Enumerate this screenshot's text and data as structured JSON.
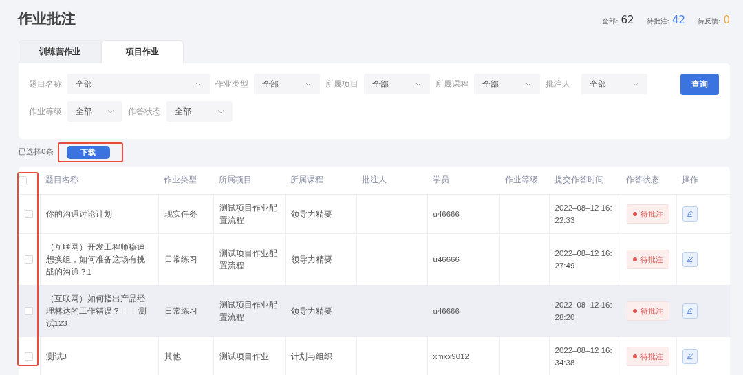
{
  "title": "作业批注",
  "stats": [
    {
      "label": "全部:",
      "value": "62",
      "color": "#333333"
    },
    {
      "label": "待批注:",
      "value": "42",
      "color": "#4a7ef0"
    },
    {
      "label": "待反馈:",
      "value": "0",
      "color": "#f2a93b"
    }
  ],
  "tabs": [
    {
      "label": "训练营作业",
      "selected": false
    },
    {
      "label": "项目作业",
      "selected": true
    }
  ],
  "filter_rows": [
    [
      {
        "label": "题目名称",
        "value": "全部"
      },
      {
        "label": "作业类型",
        "value": "全部"
      },
      {
        "label": "所属项目",
        "value": "全部"
      },
      {
        "label": "所属课程",
        "value": "全部"
      },
      {
        "label": "批注人",
        "value": "全部"
      }
    ],
    [
      {
        "label": "作业等级",
        "value": "全部"
      },
      {
        "label": "作答状态",
        "value": "全部"
      }
    ]
  ],
  "query_button": "查询",
  "selection": {
    "text": "已选择0条",
    "download_button": "下载",
    "download_highlighted": true
  },
  "table": {
    "checkbox_column_highlighted": true,
    "select_all_checked": false,
    "columns": [
      "题目名称",
      "作业类型",
      "所属项目",
      "所属课程",
      "批注人",
      "学员",
      "作业等级",
      "提交作答时间",
      "作答状态",
      "操作"
    ],
    "rows": [
      {
        "checked": false,
        "hovered": false,
        "cells": [
          "你的沟通讨论计划",
          "现实任务",
          "测试项目作业配置流程",
          "领导力精要",
          "",
          "u46666",
          "",
          "2022–08–12 16:22:33"
        ],
        "status": "待批注"
      },
      {
        "checked": false,
        "hovered": false,
        "cells": [
          "（互联网）开发工程师穆迪想换组，如何准备这场有挑战的沟通？1",
          "日常练习",
          "测试项目作业配置流程",
          "领导力精要",
          "",
          "u46666",
          "",
          "2022–08–12 16:27:49"
        ],
        "status": "待批注"
      },
      {
        "checked": false,
        "hovered": true,
        "cells": [
          "（互联网）如何指出产品经理林达的工作错误？====测试123",
          "日常练习",
          "测试项目作业配置流程",
          "领导力精要",
          "",
          "u46666",
          "",
          "2022–08–12 16:28:20"
        ],
        "status": "待批注"
      },
      {
        "checked": false,
        "hovered": false,
        "cells": [
          "测试3",
          "其他",
          "测试项目作业",
          "计划与组织",
          "",
          "xmxx9012",
          "",
          "2022–08–12 16:34:38"
        ],
        "status": "待批注"
      }
    ]
  }
}
